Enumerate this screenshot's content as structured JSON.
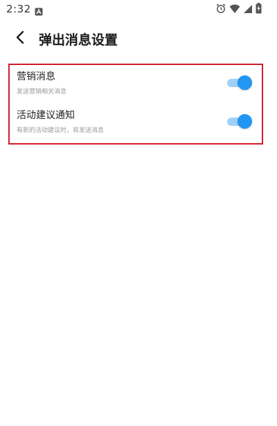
{
  "status_bar": {
    "time": "2:32",
    "icons": [
      "app-notification-icon",
      "alarm-icon",
      "wifi-icon",
      "signal-icon",
      "battery-charging-icon"
    ]
  },
  "header": {
    "back_icon": "chevron-left-icon",
    "title": "弹出消息设置"
  },
  "settings": [
    {
      "title": "营销消息",
      "description": "发送营销相关消息",
      "enabled": true
    },
    {
      "title": "活动建议通知",
      "description": "有新的活动建议时，将发送消息",
      "enabled": true
    }
  ],
  "colors": {
    "accent": "#2196f3",
    "toggle_track": "#9fd0f7",
    "highlight_border": "#d11a2a"
  }
}
